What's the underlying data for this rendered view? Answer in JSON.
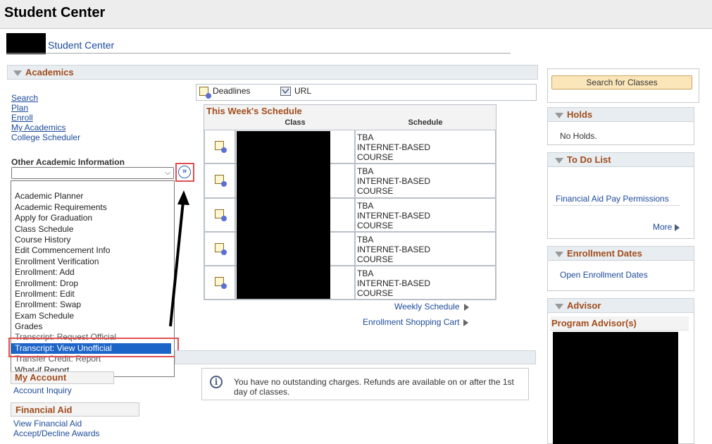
{
  "page": {
    "title": "Student Center",
    "subtitle": "Student Center"
  },
  "academics": {
    "header": "Academics",
    "nav_links": [
      "Search",
      "Plan",
      "Enroll",
      "My Academics",
      "College Scheduler"
    ],
    "other_label": "Other Academic Information",
    "select_value": "",
    "dropdown_options": [
      "Academic Planner",
      "Academic Requirements",
      "Apply for Graduation",
      "Class Schedule",
      "Course History",
      "Edit Commencement  Info",
      "Enrollment Verification",
      "Enrollment: Add",
      "Enrollment: Drop",
      "Enrollment: Edit",
      "Enrollment: Swap",
      "Exam Schedule",
      "Grades",
      "Transcript: Request Official",
      "Transcript: View Unofficial",
      "Transfer Credit: Report",
      "What-if Report"
    ],
    "selected_option": "Transcript: View Unofficial",
    "go_button_icon": "double-chevron-right-icon"
  },
  "toolbar": {
    "deadlines_label": "Deadlines",
    "url_label": "URL"
  },
  "schedule": {
    "title": "This Week's Schedule",
    "col_class": "Class",
    "col_schedule": "Schedule",
    "rows": [
      {
        "line1": "TBA",
        "line2": "INTERNET-BASED",
        "line3": "COURSE"
      },
      {
        "line1": "TBA",
        "line2": "INTERNET-BASED",
        "line3": "COURSE"
      },
      {
        "line1": "TBA",
        "line2": "INTERNET-BASED",
        "line3": "COURSE"
      },
      {
        "line1": "TBA",
        "line2": "INTERNET-BASED",
        "line3": "COURSE"
      },
      {
        "line1": "TBA",
        "line2": "INTERNET-BASED",
        "line3": "COURSE"
      }
    ],
    "weekly_link": "Weekly Schedule",
    "cart_link": "Enrollment Shopping Cart"
  },
  "finances": {
    "my_account_header": "My Account",
    "account_inquiry": "Account Inquiry",
    "charges_message": "You have no outstanding charges. Refunds are available on or after the 1st day of classes.",
    "financial_aid_header": "Financial Aid",
    "view_fin_aid": "View Financial Aid",
    "accept_decline": "Accept/Decline Awards"
  },
  "sidebar": {
    "search_button": "Search for Classes",
    "holds_header": "Holds",
    "holds_text": "No Holds.",
    "todo_header": "To Do List",
    "todo_item": "Financial Aid Pay Permissions",
    "more_link": "More",
    "enroll_dates_header": "Enrollment Dates",
    "open_enroll_link": "Open Enrollment Dates",
    "advisor_header": "Advisor",
    "program_advisor": "Program Advisor(s)"
  },
  "colors": {
    "accent_header": "#a14d1d",
    "link": "#1c4a9c",
    "highlight": "#e04f4f",
    "selected_bg": "#1c64c8"
  }
}
